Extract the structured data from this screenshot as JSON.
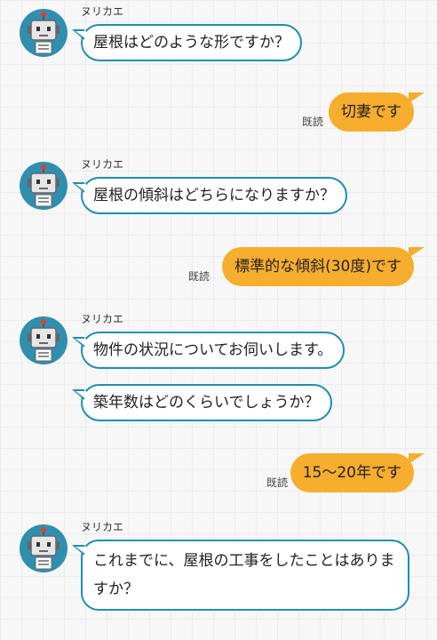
{
  "bot": {
    "name": "ヌリカエ"
  },
  "messages": {
    "q1": "屋根はどのような形ですか？",
    "a1": "切妻です",
    "q2": "屋根の傾斜はどちらになりますか？",
    "a2": "標準的な傾斜(30度)です",
    "q3a": "物件の状況についてお伺いします。",
    "q3b": "築年数はどのくらいでしょうか？",
    "a3": "15〜20年です",
    "q4": "これまでに、屋根の工事をしたことはありますか？"
  },
  "read_label": "既読",
  "colors": {
    "bot_border": "#1f8fb0",
    "user_bubble": "#f7ad2d",
    "background": "#f7f7f7"
  },
  "icons": {
    "avatar": "robot-avatar-icon"
  }
}
